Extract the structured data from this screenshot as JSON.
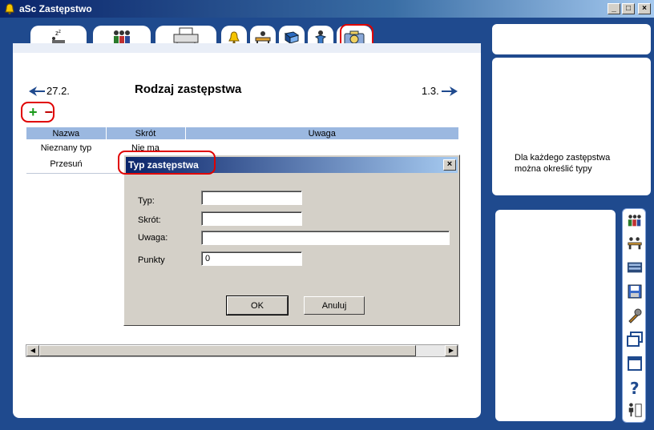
{
  "window": {
    "title": "aSc Zastępstwo",
    "controls": [
      "_",
      "□",
      "×"
    ]
  },
  "tabs": [
    {
      "name": "tab-sleep",
      "icon": "sleep-icon"
    },
    {
      "name": "tab-people",
      "icon": "people-icon"
    },
    {
      "name": "tab-printer",
      "icon": "printer-icon"
    },
    {
      "name": "tab-bell",
      "icon": "bell-icon"
    },
    {
      "name": "tab-desk",
      "icon": "desk-icon"
    },
    {
      "name": "tab-book",
      "icon": "book-icon"
    },
    {
      "name": "tab-person",
      "icon": "person-icon"
    },
    {
      "name": "tab-camera",
      "icon": "camera-icon",
      "active": true
    }
  ],
  "main": {
    "prev_label": "27.2.",
    "next_label": "1.3.",
    "title": "Rodzaj zastępstwa",
    "add_symbol": "+",
    "remove_symbol": "−",
    "columns": [
      "Nazwa",
      "Skrót",
      "Uwaga"
    ],
    "rows": [
      {
        "nazwa": "Nieznany typ",
        "skrot": "Nie ma",
        "uwaga": ""
      },
      {
        "nazwa": "Przesuń",
        "skrot": "",
        "uwaga": ""
      }
    ]
  },
  "dialog": {
    "title": "Typ zastępstwa",
    "close": "×",
    "fields": {
      "typ_label": "Typ:",
      "typ_value": "",
      "skrot_label": "Skrót:",
      "skrot_value": "",
      "uwaga_label": "Uwaga:",
      "uwaga_value": "",
      "punkty_label": "Punkty",
      "punkty_value": "0"
    },
    "ok_label": "OK",
    "cancel_label": "Anuluj"
  },
  "right_panel": {
    "hint_line1": "Dla każdego zastępstwa",
    "hint_line2": "można określić typy",
    "tools": [
      "teachers-icon",
      "classes-icon",
      "classroom-icon",
      "save-icon",
      "tools-icon",
      "windows-icon",
      "window-icon",
      "help-icon",
      "exit-icon"
    ]
  },
  "colors": {
    "frame": "#1f4a8e",
    "accent_red": "#e00000",
    "header_blue": "#9bb8e0"
  }
}
